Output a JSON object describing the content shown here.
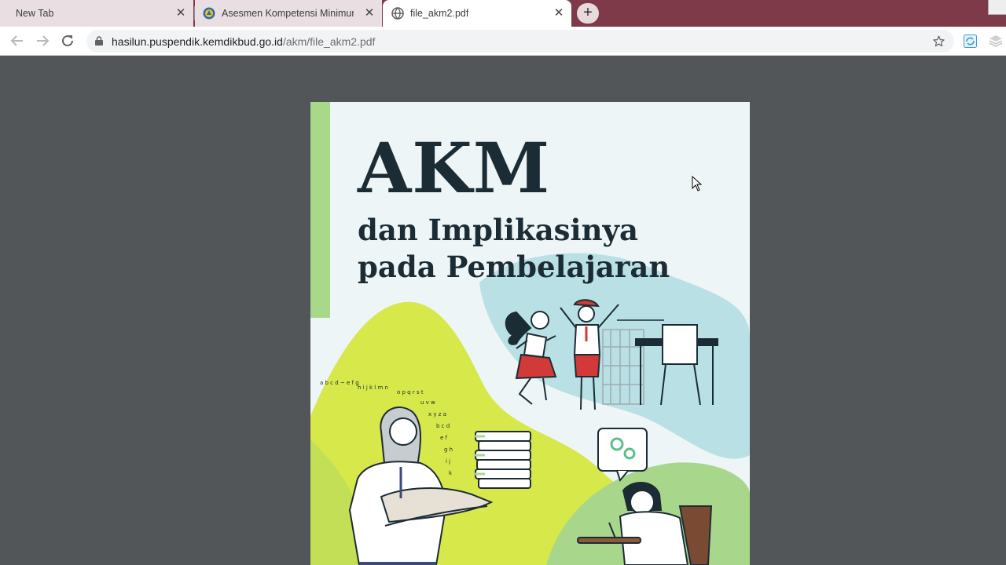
{
  "browser": {
    "tabs": [
      {
        "title": "New Tab",
        "active": false,
        "favicon": "none"
      },
      {
        "title": "Asesmen Kompetensi Minimum",
        "active": false,
        "favicon": "kemdikbud-logo-icon"
      },
      {
        "title": "file_akm2.pdf",
        "active": true,
        "favicon": "globe-icon"
      }
    ],
    "new_tab_icon": "plus-icon",
    "url_host": "hasilun.puspendik.kemdikbud.go.id",
    "url_path": "/akm/file_akm2.pdf",
    "colors": {
      "tabstrip": "#7f3a4a",
      "viewer_background": "#525659",
      "accent_green": "#a8d88a"
    }
  },
  "document": {
    "title": "AKM",
    "subtitle_line1": "dan Implikasinya",
    "subtitle_line2": "pada Pembelajaran"
  }
}
